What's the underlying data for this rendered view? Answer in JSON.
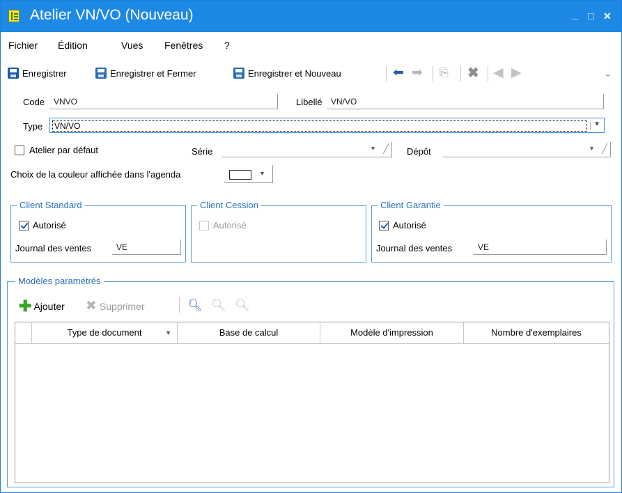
{
  "window": {
    "title": "Atelier VN/VO (Nouveau)",
    "minimize": "_",
    "maximize": "□",
    "close": "✕"
  },
  "menu": [
    "Fichier",
    "Édition",
    "Vues",
    "Fenêtres",
    "?"
  ],
  "toolbar": {
    "save_label": "Enregistrer",
    "save_close_label": "Enregistrer et Fermer",
    "save_new_label": "Enregistrer et Nouveau",
    "more_icon": "⌄"
  },
  "form": {
    "code_label": "Code",
    "code_value": "VNVO",
    "libelle_label": "Libellé",
    "libelle_value": "VN/VO",
    "type_label": "Type",
    "type_value": "VN/VO",
    "default_workshop_label": "Atelier par défaut",
    "default_workshop_checked": false,
    "serie_label": "Série",
    "serie_value": "",
    "depot_label": "Dépôt",
    "depot_value": "",
    "color_label": "Choix de la couleur affichée dans l'agenda"
  },
  "groups": {
    "standard": {
      "title": "Client Standard",
      "authorized_label": "Autorisé",
      "authorized": true,
      "journal_label": "Journal des ventes",
      "journal_value": "VE"
    },
    "cession": {
      "title": "Client Cession",
      "authorized_label": "Autorisé",
      "authorized": false
    },
    "garantie": {
      "title": "Client Garantie",
      "authorized_label": "Autorisé",
      "authorized": true,
      "journal_label": "Journal des ventes",
      "journal_value": "VE"
    }
  },
  "models": {
    "title": "Modèles paramétrés",
    "add_label": "Ajouter",
    "delete_label": "Supprimer",
    "columns": [
      "Type de document",
      "Base de calcul",
      "Modèle d'impression",
      "Nombre d'exemplaires"
    ]
  },
  "colors": {
    "accent": "#1e88e5",
    "group_border": "#5a9bd5",
    "group_title": "#2a6fbd"
  }
}
